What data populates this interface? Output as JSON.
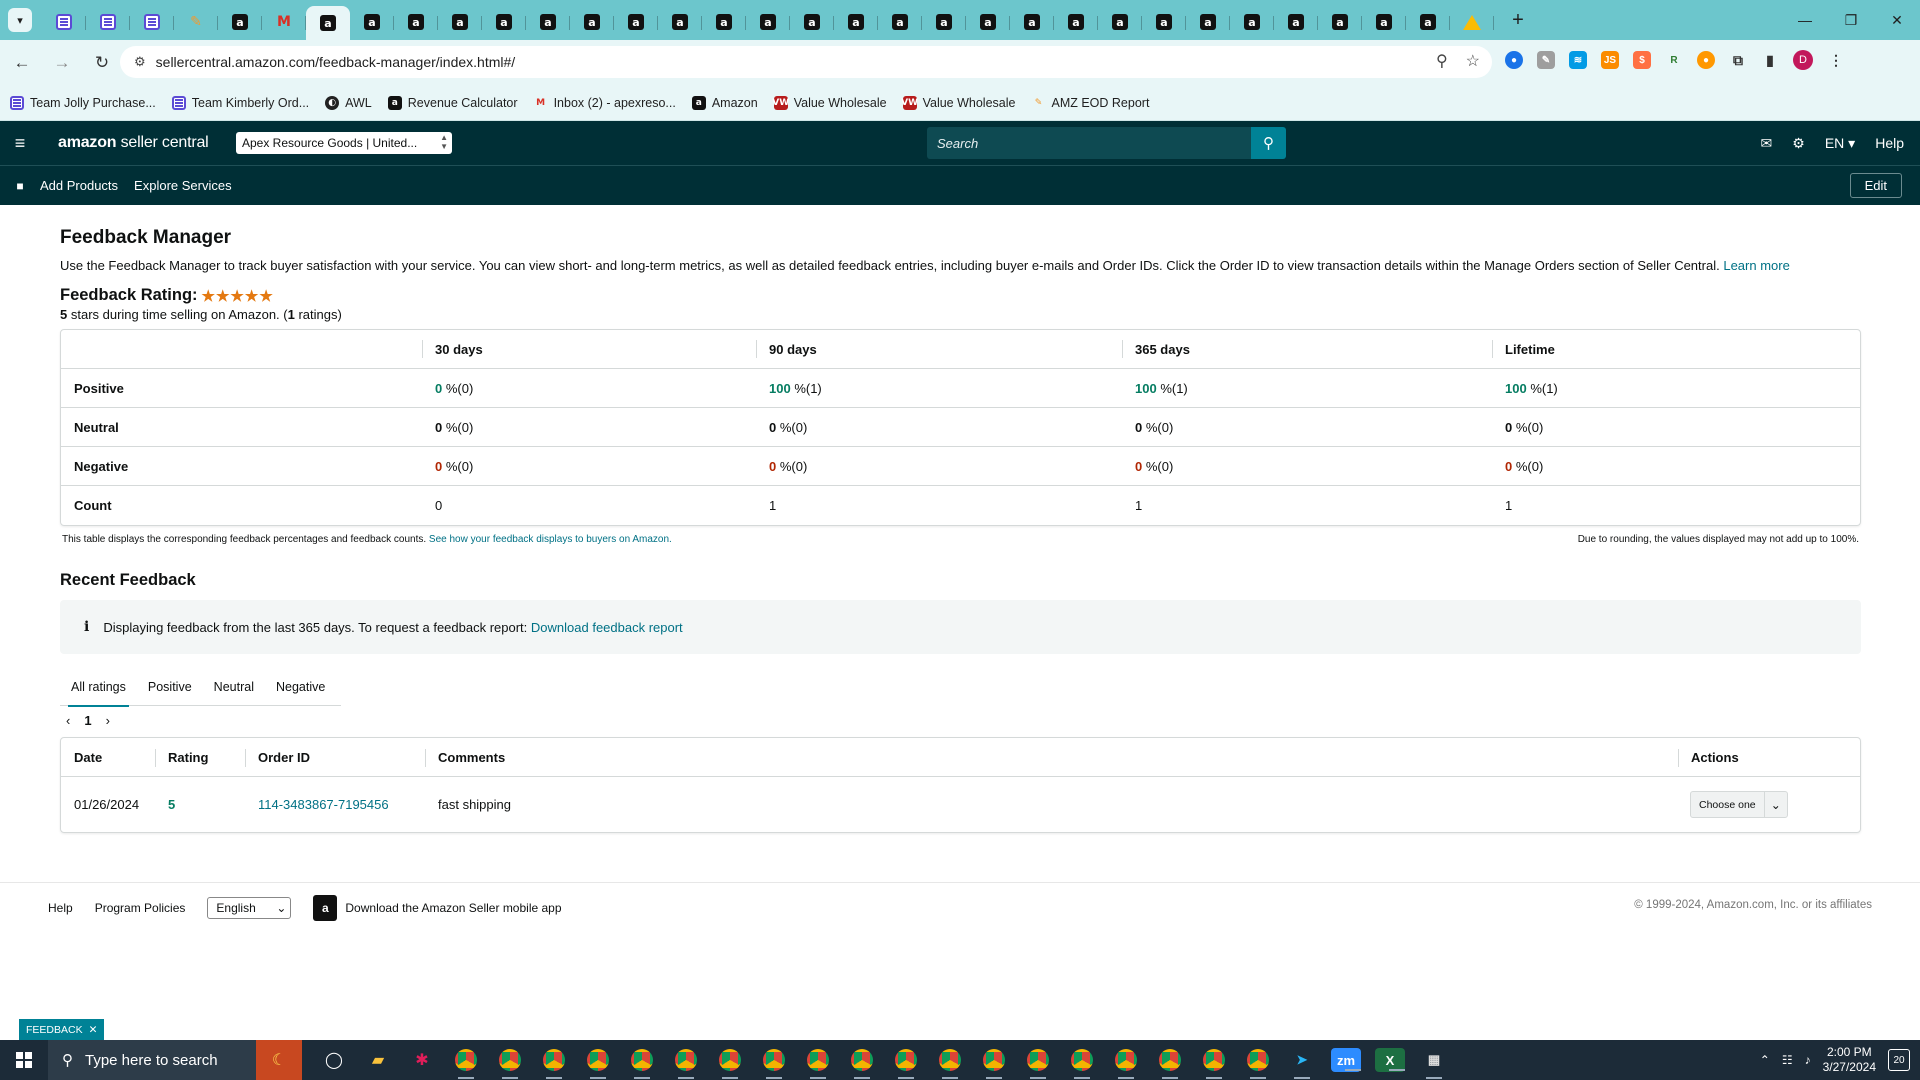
{
  "browser": {
    "url": "sellercentral.amazon.com/feedback-manager/index.html#/",
    "new_tab": "+",
    "tabs": [
      {
        "icon": "docs-icon"
      },
      {
        "icon": "docs-icon"
      },
      {
        "icon": "docs-icon"
      },
      {
        "icon": "pen-icon"
      },
      {
        "icon": "amazon-icon"
      },
      {
        "icon": "gmail-icon"
      },
      {
        "icon": "amazon-icon",
        "active": true
      },
      {
        "icon": "amazon-icon"
      },
      {
        "icon": "amazon-icon"
      },
      {
        "icon": "amazon-icon"
      },
      {
        "icon": "amazon-icon"
      },
      {
        "icon": "amazon-icon"
      },
      {
        "icon": "amazon-icon"
      },
      {
        "icon": "amazon-icon"
      },
      {
        "icon": "amazon-icon"
      },
      {
        "icon": "amazon-icon"
      },
      {
        "icon": "amazon-icon"
      },
      {
        "icon": "amazon-icon"
      },
      {
        "icon": "amazon-icon"
      },
      {
        "icon": "amazon-icon"
      },
      {
        "icon": "amazon-icon"
      },
      {
        "icon": "amazon-icon"
      },
      {
        "icon": "amazon-icon"
      },
      {
        "icon": "amazon-icon"
      },
      {
        "icon": "amazon-icon"
      },
      {
        "icon": "amazon-icon"
      },
      {
        "icon": "amazon-icon"
      },
      {
        "icon": "amazon-icon"
      },
      {
        "icon": "amazon-icon"
      },
      {
        "icon": "amazon-icon"
      },
      {
        "icon": "amazon-icon"
      },
      {
        "icon": "amazon-icon"
      },
      {
        "icon": "drive-icon"
      }
    ],
    "bookmarks": [
      {
        "label": "Team Jolly Purchase...",
        "icon": "docs-icon"
      },
      {
        "label": "Team Kimberly Ord...",
        "icon": "docs-icon"
      },
      {
        "label": "AWL",
        "icon": "awl-icon"
      },
      {
        "label": "Revenue Calculator",
        "icon": "amazon-icon"
      },
      {
        "label": "Inbox (2) - apexreso...",
        "icon": "gmail-icon"
      },
      {
        "label": "Amazon",
        "icon": "amazon-icon"
      },
      {
        "label": "Value Wholesale",
        "icon": "vw-icon"
      },
      {
        "label": "Value Wholesale",
        "icon": "vw-icon"
      },
      {
        "label": "AMZ EOD Report",
        "icon": "pen-icon"
      }
    ],
    "profile_initial": "D"
  },
  "header": {
    "logo_bold": "amazon",
    "logo_rest": " seller central",
    "store": "Apex Resource Goods | United...",
    "search_placeholder": "Search",
    "language": "EN",
    "help": "Help",
    "sub_links": [
      "Add Products",
      "Explore Services"
    ],
    "edit": "Edit"
  },
  "page": {
    "title": "Feedback Manager",
    "description": "Use the Feedback Manager to track buyer satisfaction with your service. You can view short- and long-term metrics, as well as detailed feedback entries, including buyer e-mails and Order IDs. Click the Order ID to view transaction details within the Manage Orders section of Seller Central.",
    "learn_more": "Learn more",
    "rating_label": "Feedback Rating:",
    "stars": "★★★★★",
    "rating_sub_stars": "5",
    "rating_sub_text": " stars during time selling on Amazon. (",
    "rating_sub_count": "1",
    "rating_sub_end": " ratings)"
  },
  "metrics": {
    "columns": [
      "",
      "30 days",
      "90 days",
      "365 days",
      "Lifetime"
    ],
    "rows": [
      {
        "label": "Positive",
        "type": "positive",
        "values": [
          {
            "pct": "0",
            "count": " %(0)"
          },
          {
            "pct": "100",
            "count": " %(1)"
          },
          {
            "pct": "100",
            "count": " %(1)"
          },
          {
            "pct": "100",
            "count": " %(1)"
          }
        ]
      },
      {
        "label": "Neutral",
        "type": "neutral",
        "values": [
          {
            "pct": "0",
            "count": " %(0)"
          },
          {
            "pct": "0",
            "count": " %(0)"
          },
          {
            "pct": "0",
            "count": " %(0)"
          },
          {
            "pct": "0",
            "count": " %(0)"
          }
        ]
      },
      {
        "label": "Negative",
        "type": "negative",
        "values": [
          {
            "pct": "0",
            "count": " %(0)"
          },
          {
            "pct": "0",
            "count": " %(0)"
          },
          {
            "pct": "0",
            "count": " %(0)"
          },
          {
            "pct": "0",
            "count": " %(0)"
          }
        ]
      }
    ],
    "count_row": {
      "label": "Count",
      "values": [
        "0",
        "1",
        "1",
        "1"
      ]
    },
    "note_left": "This table displays the corresponding feedback percentages and feedback counts.",
    "note_link": "See how your feedback displays to buyers on Amazon.",
    "note_right": "Due to rounding, the values displayed may not add up to 100%."
  },
  "recent": {
    "title": "Recent Feedback",
    "info_text": "Displaying feedback from the last 365 days. To request a feedback report:",
    "info_link": "Download feedback report",
    "tabs": [
      "All ratings",
      "Positive",
      "Neutral",
      "Negative"
    ],
    "active_tab": "All ratings",
    "page": "1",
    "columns": {
      "date": "Date",
      "rating": "Rating",
      "order": "Order ID",
      "comments": "Comments",
      "actions": "Actions"
    },
    "rows": [
      {
        "date": "01/26/2024",
        "rating": "5",
        "order_id": "114-3483867-7195456",
        "comments": "fast shipping",
        "action": "Choose one"
      }
    ]
  },
  "footer": {
    "help": "Help",
    "policies": "Program Policies",
    "language": "English",
    "app_text": "Download the Amazon Seller mobile app",
    "copyright": "© 1999-2024, Amazon.com, Inc. or its affiliates"
  },
  "feedback_tab": "FEEDBACK",
  "taskbar": {
    "search_placeholder": "Type here to search",
    "time": "2:00 PM",
    "date": "3/27/2024",
    "notifications": "20"
  },
  "colors": {
    "header": "#002f36",
    "accent": "#008296",
    "link": "#007185",
    "positive": "#067d62",
    "negative": "#b12704",
    "browser_frame": "#6cc6cc"
  }
}
